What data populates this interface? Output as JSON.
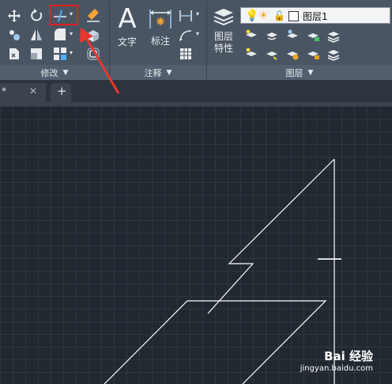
{
  "ribbon": {
    "panels": {
      "modify": {
        "label": "修改"
      },
      "annotation": {
        "label": "注释",
        "text_button": "文字",
        "dimension_button": "标注"
      },
      "layers": {
        "label": "图层",
        "layer_properties": "图层\n特性",
        "current_layer": "图层1"
      }
    }
  },
  "tabs": {
    "first_tab": "*"
  },
  "watermark": {
    "line1": "Bai 经验",
    "line2": "jingyan.baidu.com"
  },
  "colors": {
    "highlight_box": "#e02020",
    "arrow": "#e8372f",
    "drawing_lines": "#ffffff"
  }
}
